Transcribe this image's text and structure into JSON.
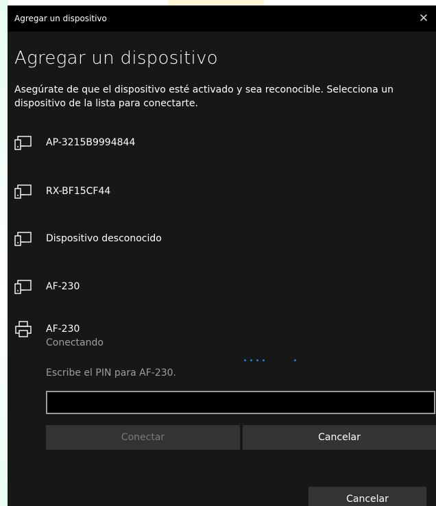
{
  "window": {
    "title": "Agregar un dispositivo",
    "close_glyph": "✕"
  },
  "heading": "Agregar un dispositivo",
  "description": "Asegúrate de que el dispositivo esté activado y sea reconocible. Selecciona un dispositivo de la lista para conectarte.",
  "devices": [
    {
      "name": "AP-3215B9994844",
      "icon": "display-icon"
    },
    {
      "name": "RX-BF15CF44",
      "icon": "display-icon"
    },
    {
      "name": "Dispositivo desconocido",
      "icon": "display-icon"
    },
    {
      "name": "AF-230",
      "icon": "display-icon"
    },
    {
      "name": "AF-230",
      "icon": "printer-icon",
      "status": "Conectando"
    }
  ],
  "pin": {
    "label": "Escribe el PIN para AF-230.",
    "value": "",
    "placeholder": ""
  },
  "buttons": {
    "connect": "Conectar",
    "cancel": "Cancelar",
    "footer_cancel": "Cancelar"
  },
  "colors": {
    "background": "#171717",
    "titlebar": "#000000",
    "accent": "#1e7fd8",
    "button": "#333333"
  }
}
